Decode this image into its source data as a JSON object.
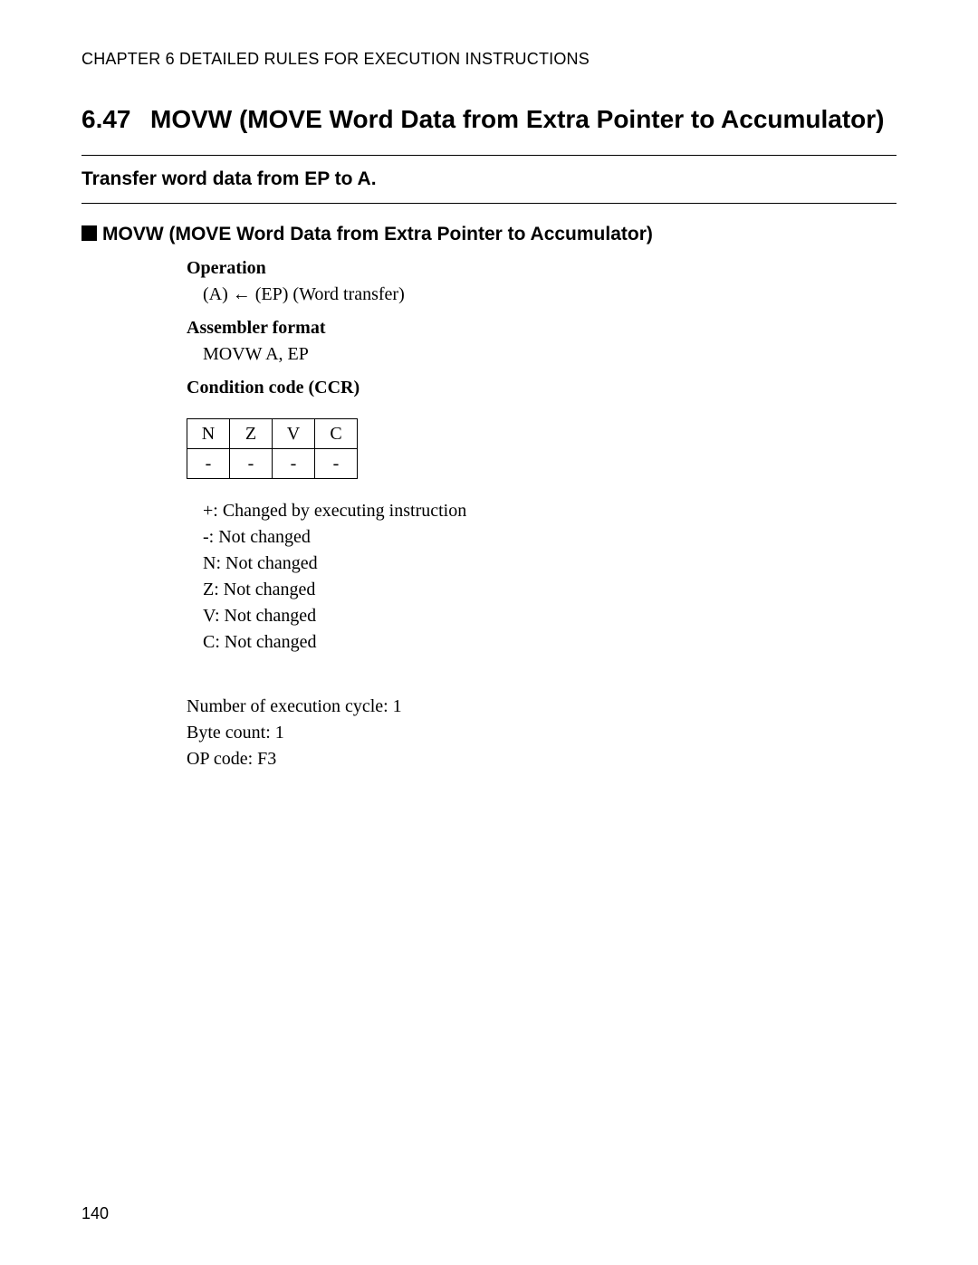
{
  "chapter_header": "CHAPTER 6  DETAILED RULES FOR EXECUTION INSTRUCTIONS",
  "section": {
    "number": "6.47",
    "title": "MOVW (MOVE Word Data from Extra Pointer to Accumulator)"
  },
  "summary": "Transfer word data from EP to A.",
  "subheading": "MOVW (MOVE Word Data from Extra Pointer to Accumulator)",
  "operation": {
    "label": "Operation",
    "value": "(A) ← (EP) (Word transfer)"
  },
  "assembler_format": {
    "label": "Assembler format",
    "value": "MOVW A, EP"
  },
  "ccr": {
    "label": "Condition code (CCR)",
    "headers": [
      "N",
      "Z",
      "V",
      "C"
    ],
    "values": [
      "-",
      "-",
      "-",
      "-"
    ],
    "explain": [
      "+: Changed by executing instruction",
      "-: Not changed",
      "N: Not changed",
      "Z: Not changed",
      "V: Not changed",
      "C: Not changed"
    ]
  },
  "stats": {
    "exec_cycle": "Number of execution cycle: 1",
    "byte_count": "Byte count: 1",
    "op_code": "OP code: F3"
  },
  "page_number": "140"
}
